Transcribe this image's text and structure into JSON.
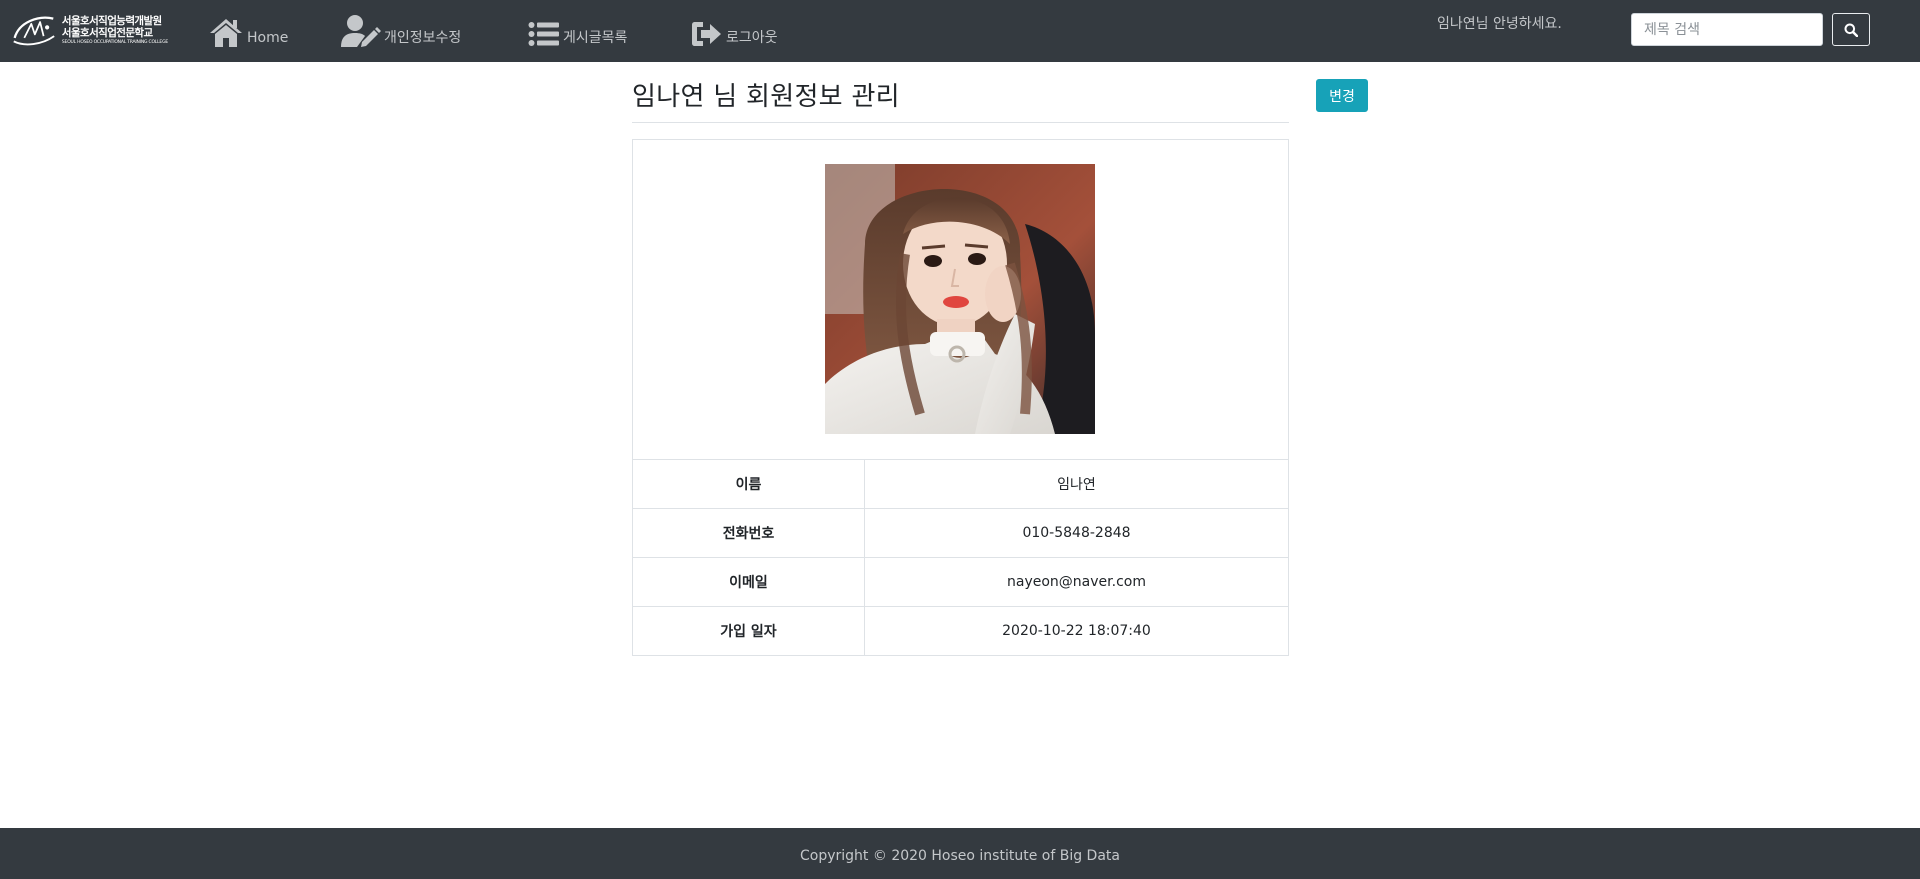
{
  "header": {
    "logo": {
      "line1": "서울호서직업능력개발원",
      "line2": "서울호서직업전문학교",
      "line3": "SEOUL HOSEO OCCUPATIONAL TRAINING COLLEGE"
    },
    "nav": [
      {
        "label": "Home",
        "icon": "home-icon"
      },
      {
        "label": "개인정보수정",
        "icon": "user-edit-icon"
      },
      {
        "label": "게시글목록",
        "icon": "list-icon"
      },
      {
        "label": "로그아웃",
        "icon": "sign-out-icon"
      }
    ],
    "greeting": "임나연님 안녕하세요.",
    "search": {
      "placeholder": "제목 검색",
      "value": "",
      "icon": "search-icon"
    }
  },
  "main": {
    "title": "임나연 님 회원정보 관리",
    "change_button": "변경",
    "photo": {
      "description": "profile-photo"
    },
    "rows": [
      {
        "label": "이름",
        "value": "임나연"
      },
      {
        "label": "전화번호",
        "value": "010-5848-2848"
      },
      {
        "label": "이메일",
        "value": "nayeon@naver.com"
      },
      {
        "label": "가입 일자",
        "value": "2020-10-22 18:07:40"
      }
    ]
  },
  "footer": {
    "text": "Copyright © 2020 Hoseo institute of Big Data"
  },
  "colors": {
    "navbar": "#343a40",
    "accent": "#17a2b8",
    "nav_text": "#c4c7ca"
  }
}
